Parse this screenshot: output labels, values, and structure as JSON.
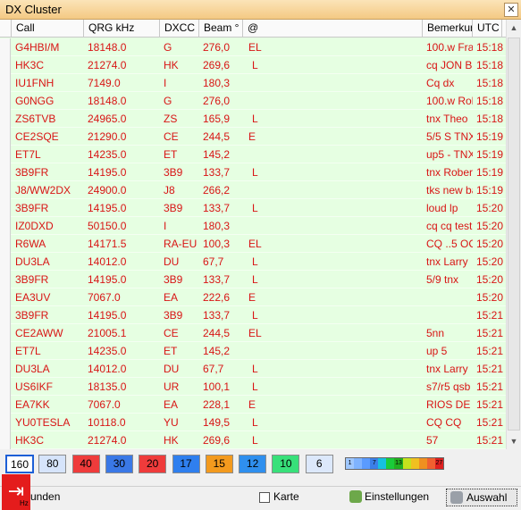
{
  "window": {
    "title": "DX Cluster",
    "close_glyph": "✕"
  },
  "columns": [
    "Call",
    "QRG kHz",
    "DXCC",
    "Beam °",
    "@",
    "Bemerkun",
    "UTC"
  ],
  "rows": [
    [
      "G4HBI/M",
      "18148.0",
      "G",
      "276,0",
      "EL",
      "100.w Fra",
      "15:18"
    ],
    [
      "HK3C",
      "21274.0",
      "HK",
      "269,6",
      "L",
      "cq JON BC",
      "15:18"
    ],
    [
      "IU1FNH",
      "7149.0",
      "I",
      "180,3",
      "",
      "Cq dx",
      "15:18"
    ],
    [
      "G0NGG",
      "18148.0",
      "G",
      "276,0",
      "",
      "100.w Rol",
      "15:18"
    ],
    [
      "ZS6TVB",
      "24965.0",
      "ZS",
      "165,9",
      "L",
      "tnx Theo",
      "15:18"
    ],
    [
      "CE2SQE",
      "21290.0",
      "CE",
      "244,5",
      "E",
      "5/5 S TNX",
      "15:19"
    ],
    [
      "ET7L",
      "14235.0",
      "ET",
      "145,2",
      "",
      "up5 - TNX",
      "15:19"
    ],
    [
      "3B9FR",
      "14195.0",
      "3B9",
      "133,7",
      "L",
      "tnx Robert",
      "15:19"
    ],
    [
      "J8/WW2DX",
      "24900.0",
      "J8",
      "266,2",
      "",
      "tks new ba",
      "15:19"
    ],
    [
      "3B9FR",
      "14195.0",
      "3B9",
      "133,7",
      "L",
      "loud lp",
      "15:20"
    ],
    [
      "IZ0DXD",
      "50150.0",
      "I",
      "180,3",
      "",
      "cq cq test",
      "15:20"
    ],
    [
      "R6WA",
      "14171.5",
      "RA-EU",
      "100,3",
      "EL",
      "CQ ..5 OC",
      "15:20"
    ],
    [
      "DU3LA",
      "14012.0",
      "DU",
      "67,7",
      "L",
      "tnx Larry",
      "15:20"
    ],
    [
      "3B9FR",
      "14195.0",
      "3B9",
      "133,7",
      "L",
      "5/9 tnx",
      "15:20"
    ],
    [
      "EA3UV",
      "7067.0",
      "EA",
      "222,6",
      "E",
      "",
      "15:20"
    ],
    [
      "3B9FR",
      "14195.0",
      "3B9",
      "133,7",
      "L",
      "",
      "15:21"
    ],
    [
      "CE2AWW",
      "21005.1",
      "CE",
      "244,5",
      "EL",
      "5nn",
      "15:21"
    ],
    [
      "ET7L",
      "14235.0",
      "ET",
      "145,2",
      "",
      "up 5",
      "15:21"
    ],
    [
      "DU3LA",
      "14012.0",
      "DU",
      "67,7",
      "L",
      "tnx Larry",
      "15:21"
    ],
    [
      "US6IKF",
      "18135.0",
      "UR",
      "100,1",
      "L",
      "s7/r5 qsb",
      "15:21"
    ],
    [
      "EA7KK",
      "7067.0",
      "EA",
      "228,1",
      "E",
      "RIOS DE I",
      "15:21"
    ],
    [
      "YU0TESLA",
      "10118.0",
      "YU",
      "149,5",
      "L",
      "CQ CQ",
      "15:21"
    ],
    [
      "HK3C",
      "21274.0",
      "HK",
      "269,6",
      "L",
      "57",
      "15:21"
    ]
  ],
  "bands": [
    {
      "label": "160",
      "bg": "#ffffff"
    },
    {
      "label": "80",
      "bg": "#d6e4fb"
    },
    {
      "label": "40",
      "bg": "#ef3b3b"
    },
    {
      "label": "30",
      "bg": "#3a78e6"
    },
    {
      "label": "20",
      "bg": "#ef3b3b"
    },
    {
      "label": "17",
      "bg": "#2f7fee"
    },
    {
      "label": "15",
      "bg": "#f39a1e"
    },
    {
      "label": "12",
      "bg": "#2f8fee"
    },
    {
      "label": "10",
      "bg": "#38e07a"
    },
    {
      "label": "6",
      "bg": "#dce8fb"
    }
  ],
  "legend": [
    {
      "label": "1",
      "color": "#9fc7ff"
    },
    {
      "label": "",
      "color": "#7fb3ff"
    },
    {
      "label": "",
      "color": "#5a9bff"
    },
    {
      "label": "7",
      "color": "#3b7fe8"
    },
    {
      "label": "",
      "color": "#16c0e0"
    },
    {
      "label": "",
      "color": "#1acc3a"
    },
    {
      "label": "13",
      "color": "#22b020"
    },
    {
      "label": "",
      "color": "#c5e21d"
    },
    {
      "label": "",
      "color": "#f0c020"
    },
    {
      "label": "",
      "color": "#f09020"
    },
    {
      "label": "",
      "color": "#f06030"
    },
    {
      "label": "27",
      "color": "#e02020"
    }
  ],
  "status": {
    "partial_left": "unden",
    "small_hz": "Hz",
    "map_label": "Karte",
    "settings_label": "Einstellungen",
    "select_label": "Auswahl",
    "logo_glyph": "⇥"
  },
  "scroll": {
    "up": "▲",
    "down": "▼"
  }
}
